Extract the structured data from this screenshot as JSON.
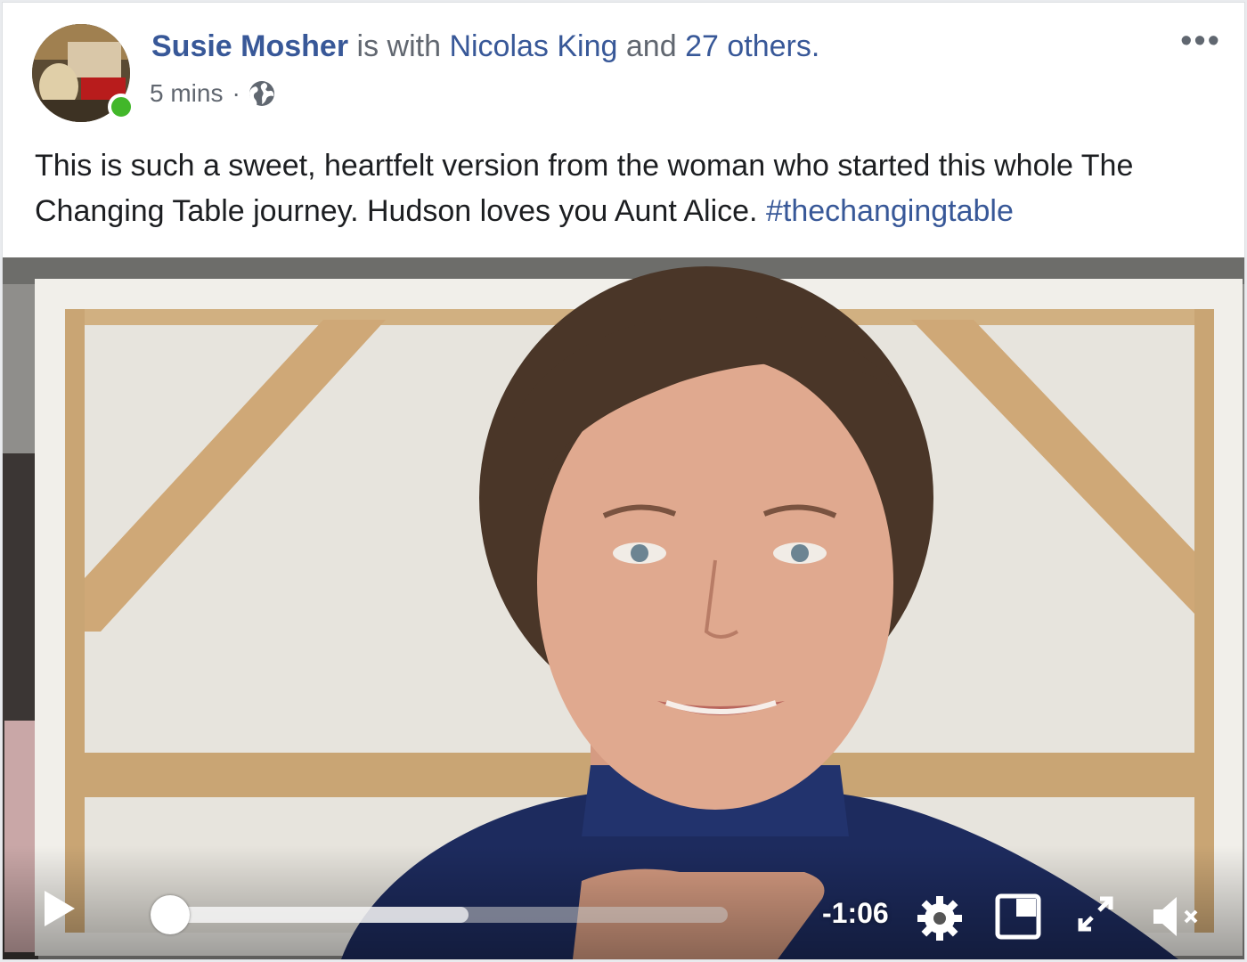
{
  "post": {
    "author": "Susie Mosher",
    "with_text": "is with",
    "tagged_person": "Nicolas King",
    "and_text": "and",
    "others": "27 others.",
    "timestamp": "5 mins",
    "separator": "·",
    "audience_icon": "globe-icon",
    "menu_icon": "more-options-icon",
    "caption_text": "This is such a sweet, heartfelt version from the woman who started this whole The Changing Table journey. Hudson loves you Aunt Alice.",
    "hashtag": "#thechangingtable",
    "online_status_color": "#42b72a"
  },
  "video": {
    "time_remaining": "-1:06",
    "progress_buffered_fraction": 0.55,
    "progress_played_fraction": 0.0,
    "controls": {
      "play_icon": "play-icon",
      "settings_icon": "gear-icon",
      "pip_icon": "picture-in-picture-icon",
      "fullscreen_icon": "fullscreen-icon",
      "volume_icon": "volume-muted-icon"
    }
  },
  "colors": {
    "link": "#385898",
    "text": "#1c1e21",
    "meta": "#616770"
  }
}
